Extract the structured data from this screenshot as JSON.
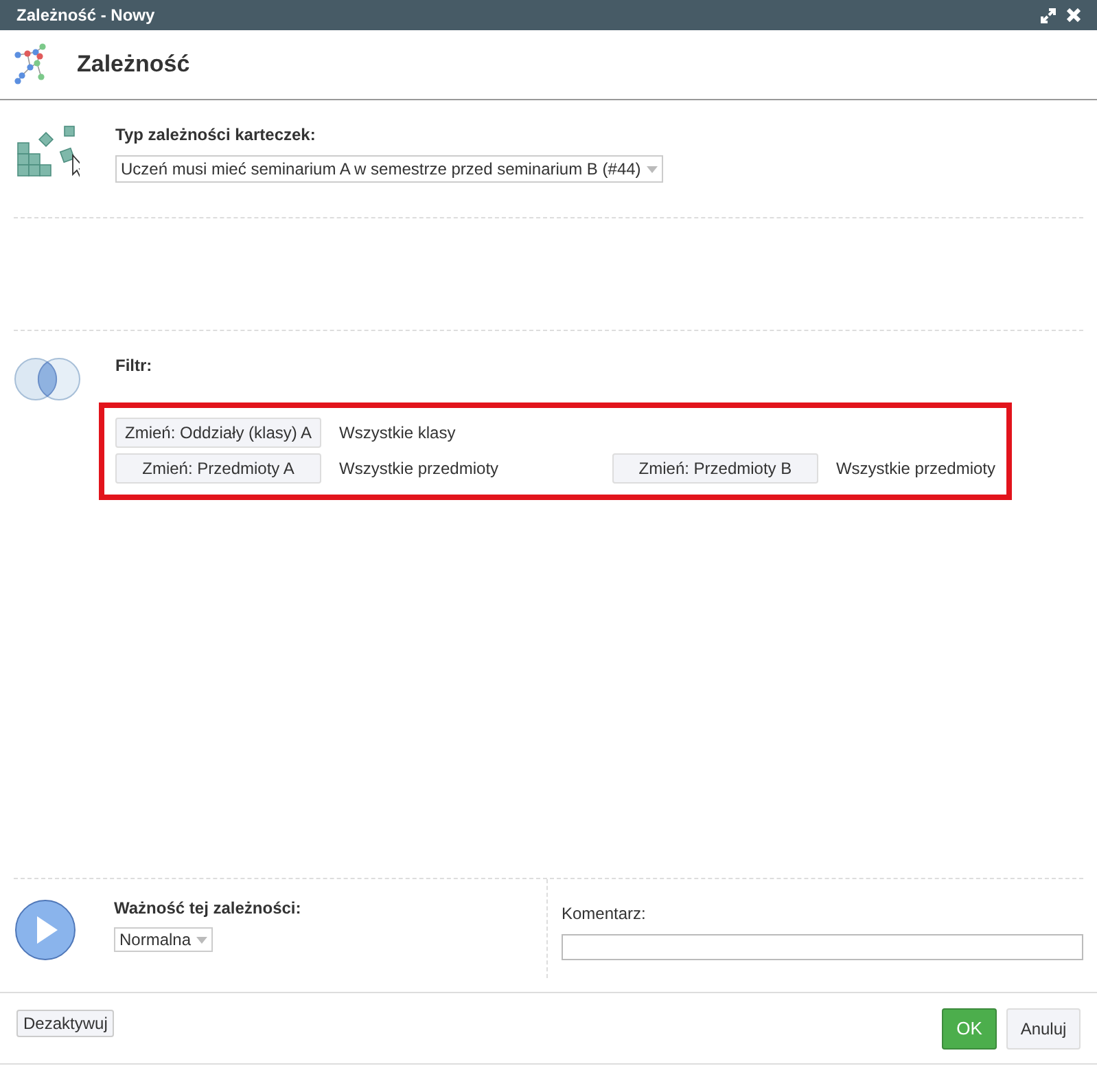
{
  "window": {
    "title": "Zależność - Nowy"
  },
  "header": {
    "title": "Zależność"
  },
  "card_type": {
    "label": "Typ zależności karteczek:",
    "value": "Uczeń musi mieć seminarium A w semestrze przed seminarium B (#44)"
  },
  "filter": {
    "label": "Filtr:",
    "highlighted": true,
    "rows": [
      {
        "items": [
          {
            "button": "Zmień: Oddziały (klasy) A",
            "value": "Wszystkie klasy"
          }
        ]
      },
      {
        "items": [
          {
            "button": "Zmień: Przedmioty A",
            "value": "Wszystkie przedmioty"
          },
          {
            "button": "Zmień: Przedmioty B",
            "value": "Wszystkie przedmioty"
          }
        ]
      }
    ]
  },
  "importance": {
    "label": "Ważność tej zależności:",
    "value": "Normalna"
  },
  "comment": {
    "label": "Komentarz:"
  },
  "footer": {
    "deactivate": "Dezaktywuj",
    "ok": "OK",
    "cancel": "Anuluj"
  }
}
